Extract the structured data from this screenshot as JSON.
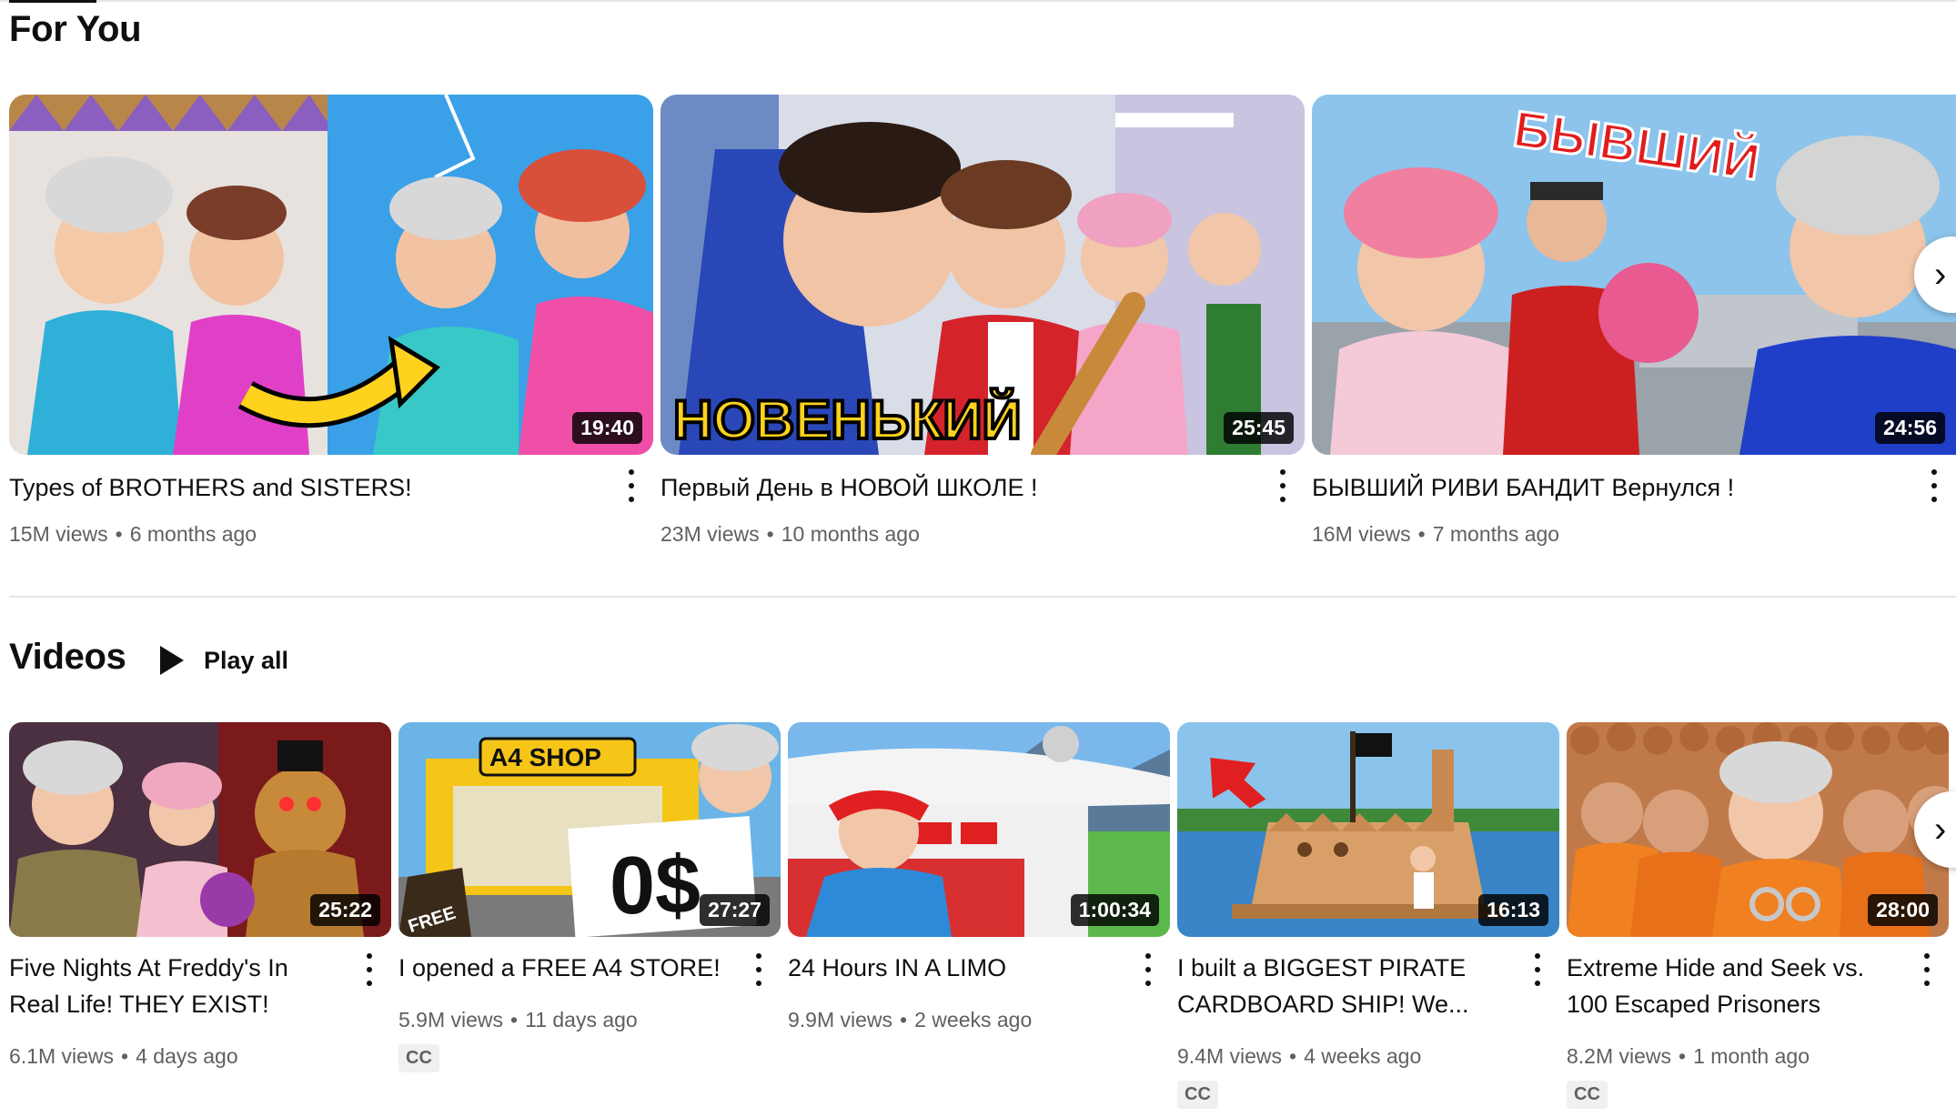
{
  "for_you": {
    "title": "For You",
    "videos": [
      {
        "title": "Types of BROTHERS and SISTERS!",
        "duration": "19:40",
        "views": "15M views",
        "age": "6 months ago"
      },
      {
        "title": "Первый День в НОВОЙ ШКОЛЕ !",
        "duration": "25:45",
        "views": "23M views",
        "age": "10 months ago",
        "thumb_text": "НОВЕНЬКИЙ"
      },
      {
        "title": "БЫВШИЙ РИВИ БАНДИТ Вернулся !",
        "duration": "24:56",
        "views": "16M views",
        "age": "7 months ago",
        "thumb_text": "БЫВШИЙ"
      }
    ]
  },
  "videos": {
    "title": "Videos",
    "play_all_label": "Play all",
    "items": [
      {
        "title_line1": "Five Nights At Freddy's In",
        "title_line2": "Real Life! THEY EXIST!",
        "duration": "25:22",
        "views": "6.1M views",
        "age": "4 days ago"
      },
      {
        "title_line1": "I opened a FREE A4 STORE!",
        "title_line2": "",
        "duration": "27:27",
        "views": "5.9M views",
        "age": "11 days ago",
        "cc": "CC",
        "thumb_text_1": "A4 SHOP",
        "thumb_text_2": "0$",
        "thumb_text_3": "FREE"
      },
      {
        "title_line1": "24 Hours IN A LIMO",
        "title_line2": "",
        "duration": "1:00:34",
        "views": "9.9M views",
        "age": "2 weeks ago"
      },
      {
        "title_line1": "I built a BIGGEST PIRATE",
        "title_line2": "CARDBOARD SHIP! We...",
        "duration": "16:13",
        "views": "9.4M views",
        "age": "4 weeks ago",
        "cc": "CC"
      },
      {
        "title_line1": "Extreme Hide and Seek vs.",
        "title_line2": "100 Escaped Prisoners",
        "duration": "28:00",
        "views": "8.2M views",
        "age": "1 month ago",
        "cc": "CC"
      }
    ]
  },
  "icons": {
    "next": "chevron-right-icon",
    "more": "more-vert-icon",
    "play": "play-icon"
  },
  "colors": {
    "text": "#0f0f0f",
    "meta": "#606060",
    "badge_bg": "#000000",
    "divider": "#e5e5e5"
  }
}
